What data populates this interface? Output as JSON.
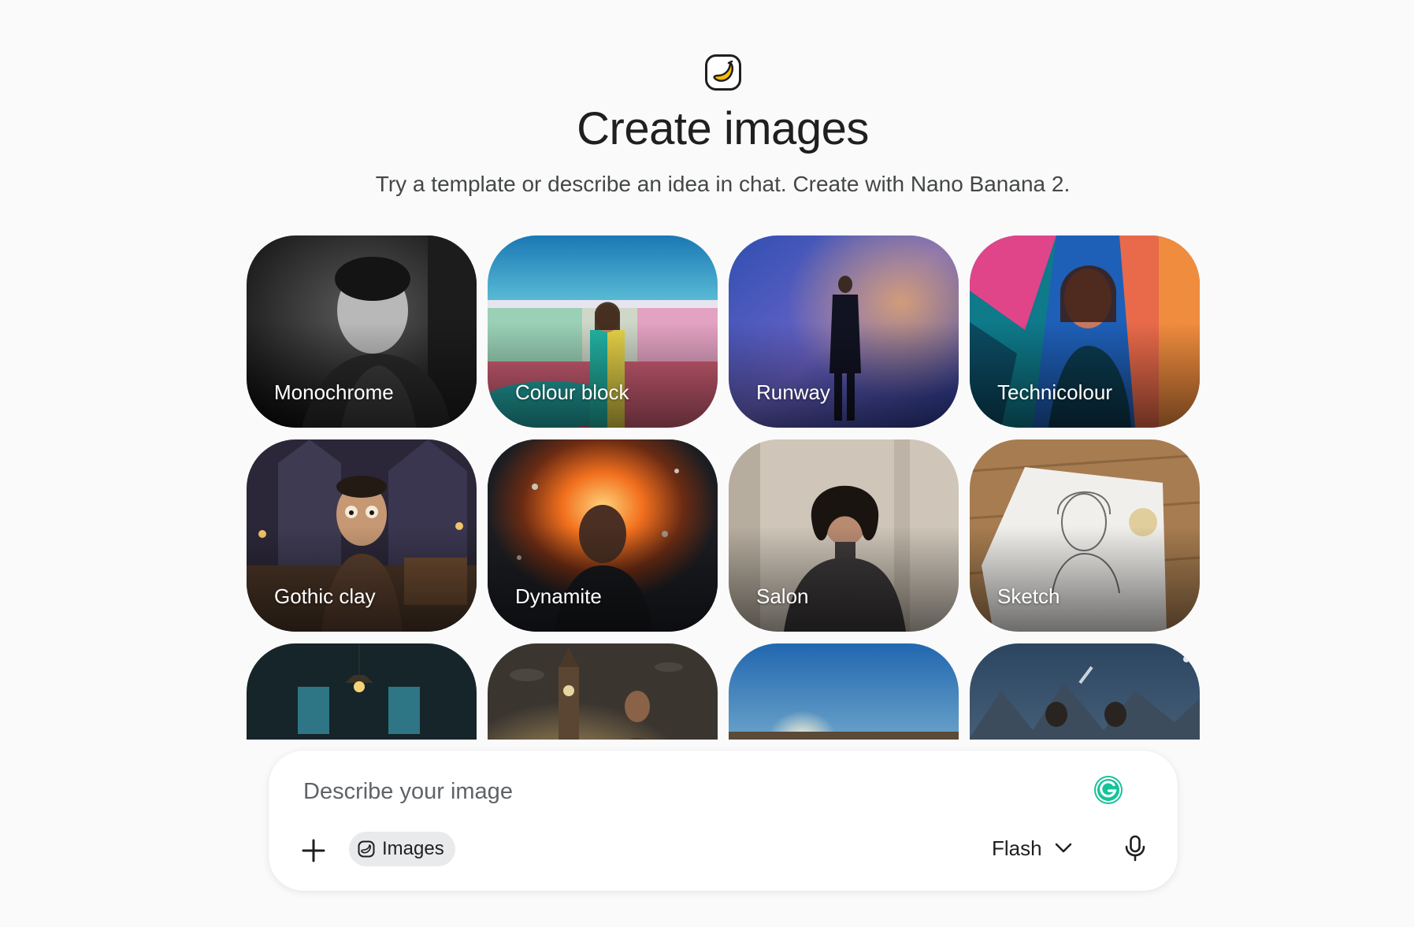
{
  "header": {
    "logo_icon": "banana-icon",
    "title": "Create images",
    "subtitle": "Try a template or describe an idea in chat. Create with Nano Banana 2."
  },
  "templates": [
    {
      "label": "Monochrome"
    },
    {
      "label": "Colour block"
    },
    {
      "label": "Runway"
    },
    {
      "label": "Technicolour"
    },
    {
      "label": "Gothic clay"
    },
    {
      "label": "Dynamite"
    },
    {
      "label": "Salon"
    },
    {
      "label": "Sketch"
    },
    {
      "label": ""
    },
    {
      "label": ""
    },
    {
      "label": ""
    },
    {
      "label": ""
    }
  ],
  "composer": {
    "placeholder": "Describe your image",
    "value": "",
    "add_icon": "plus-icon",
    "tool_chip": {
      "label": "Images",
      "icon": "images-icon"
    },
    "model": {
      "label": "Flash",
      "icon": "chevron-down-icon"
    },
    "mic_icon": "microphone-icon",
    "grammarly_icon": "grammarly-icon"
  },
  "colors": {
    "background": "#fafafa",
    "title": "#1f1f1f",
    "subtitle": "#444746",
    "chip_bg": "#e9eaec",
    "grammarly_green": "#15c39a",
    "banana_yellow": "#fbbc04"
  }
}
